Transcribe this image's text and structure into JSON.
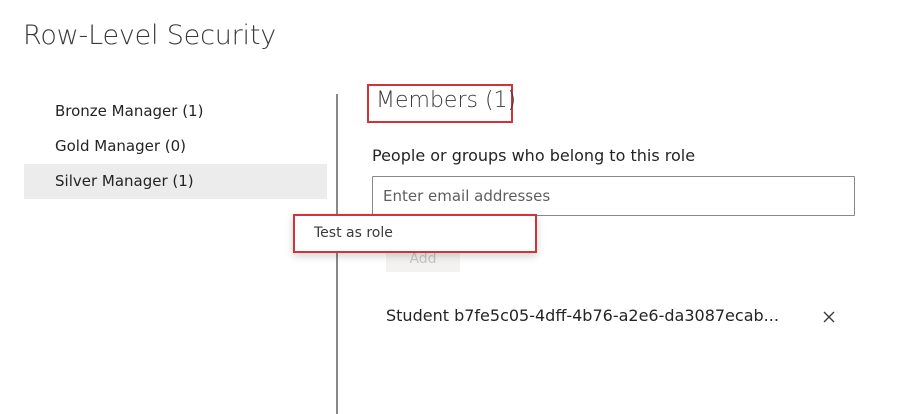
{
  "page": {
    "title": "Row-Level Security"
  },
  "roles": {
    "items": [
      {
        "label": "Bronze Manager (1)"
      },
      {
        "label": "Gold Manager (0)"
      },
      {
        "label": "Silver Manager (1)"
      }
    ],
    "selected": "Silver Manager (1)"
  },
  "members": {
    "heading": "Members (1)",
    "field_label": "People or groups who belong to this role",
    "input_placeholder": "Enter email addresses",
    "input_value": "",
    "add_label": "Add",
    "list": [
      {
        "name": "Student b7fe5c05-4dff-4b76-a2e6-da3087ecab..."
      }
    ]
  },
  "context_menu": {
    "items": [
      {
        "label": "Test as role"
      }
    ]
  },
  "icons": {
    "remove_member": "close-icon"
  },
  "colors": {
    "highlight_border": "#d13438",
    "selected_row": "#ececec",
    "divider": "#8a8886"
  }
}
